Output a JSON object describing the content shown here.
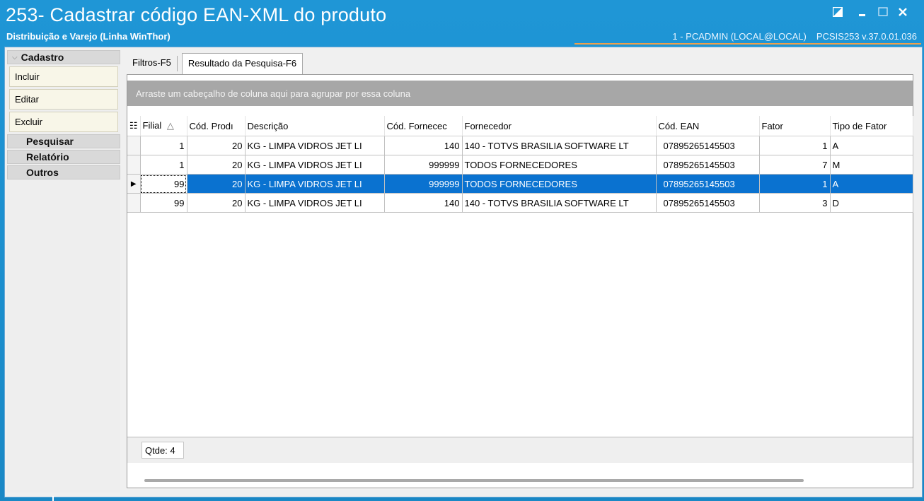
{
  "window": {
    "title": "253- Cadastrar código EAN-XML do produto",
    "subtitle": "Distribuição e Varejo (Linha WinThor)",
    "user": "1 - PCADMIN (LOCAL@LOCAL)",
    "module": "PCSIS253  v.37.0.01.036",
    "accent_color": "#1b8ecd",
    "highlight_color": "#f0a04b"
  },
  "sidebar": {
    "header": "Cadastro",
    "items": [
      "Incluir",
      "Editar",
      "Excluir"
    ],
    "sections": [
      "Pesquisar",
      "Relatório",
      "Outros"
    ]
  },
  "tabs": [
    {
      "label": "Filtros-F5",
      "active": false
    },
    {
      "label": "Resultado da Pesquisa-F6",
      "active": true
    }
  ],
  "grid": {
    "group_hint": "Arraste um cabeçalho de coluna aqui para agrupar por essa coluna",
    "columns": [
      "Filial",
      "Cód. Prodı",
      "Descrição",
      "Cód. Fornecec",
      "Fornecedor",
      "Cód. EAN",
      "Fator",
      "Tipo de Fator"
    ],
    "sort_indicator": "△",
    "rows": [
      [
        "1",
        "20",
        "KG - LIMPA VIDROS JET LI",
        "140",
        "140 - TOTVS BRASILIA SOFTWARE LT",
        "07895265145503",
        "1",
        "A"
      ],
      [
        "1",
        "20",
        "KG - LIMPA VIDROS JET LI",
        "999999",
        "TODOS FORNECEDORES",
        "07895265145503",
        "7",
        "M"
      ],
      [
        "99",
        "20",
        "KG - LIMPA VIDROS JET LI",
        "999999",
        "TODOS FORNECEDORES",
        "07895265145503",
        "1",
        "A"
      ],
      [
        "99",
        "20",
        "KG - LIMPA VIDROS JET LI",
        "140",
        "140 - TOTVS BRASILIA SOFTWARE LT",
        "07895265145503",
        "3",
        "D"
      ]
    ],
    "selected_row": 2,
    "selection_color": "#0a72d0",
    "footer_count": "Qtde: 4"
  }
}
